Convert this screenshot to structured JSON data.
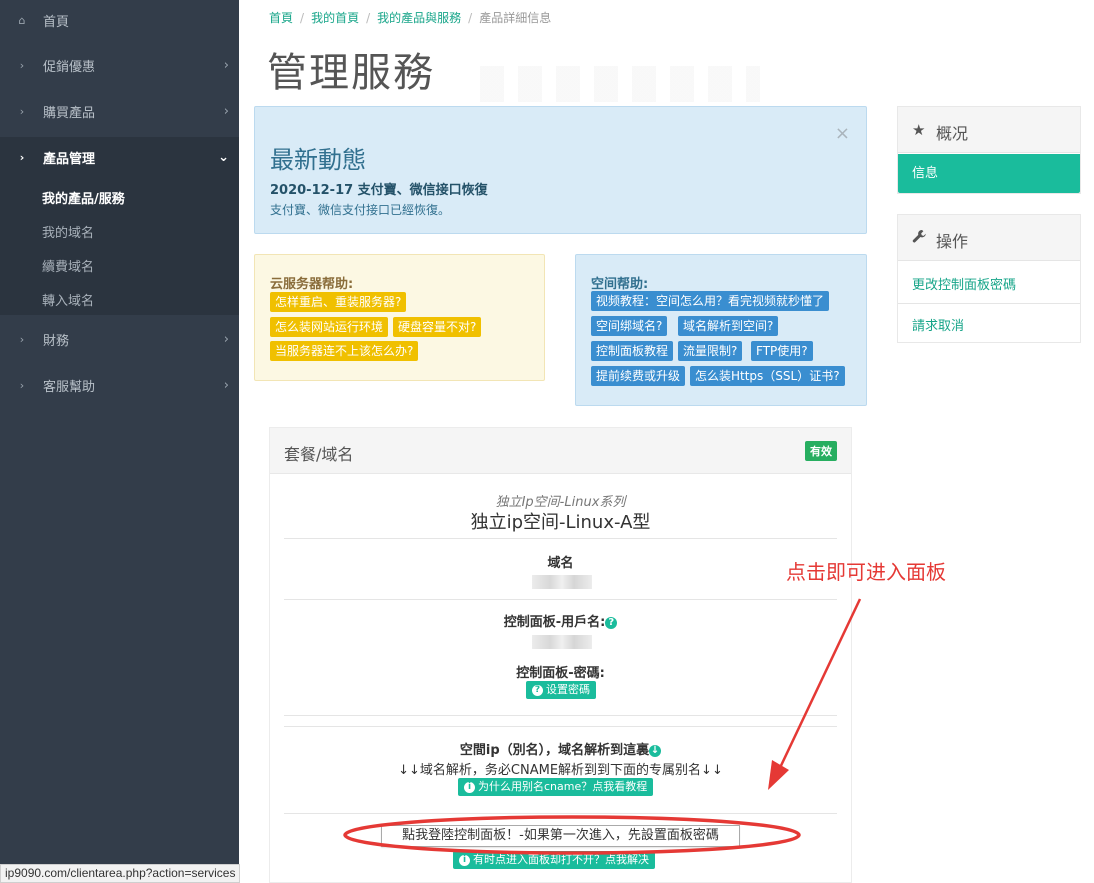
{
  "sidebar": {
    "items": [
      {
        "label": "首頁",
        "lead": "⌂"
      },
      {
        "label": "促銷優惠",
        "lead": "›"
      },
      {
        "label": "購買產品",
        "lead": "›"
      },
      {
        "label": "產品管理",
        "lead": "›"
      },
      {
        "label": "財務",
        "lead": "›"
      },
      {
        "label": "客服幫助",
        "lead": "›"
      }
    ],
    "sub_items": [
      "我的產品/服務",
      "我的域名",
      "續費域名",
      "轉入域名"
    ]
  },
  "breadcrumb": [
    "首頁",
    "我的首頁",
    "我的產品與服務",
    "產品詳細信息"
  ],
  "page_title": "管理服務",
  "announcement": {
    "heading": "最新動態",
    "date_title": "2020-12-17 支付寶、微信接口恢復",
    "body": "支付寶、微信支付接口已經恢復。",
    "close": "×"
  },
  "help_cloud": {
    "title": "云服务器帮助:",
    "tags": [
      "怎样重启、重装服务器?",
      "怎么装网站运行环境",
      "硬盘容量不对?",
      "当服务器连不上该怎么办?"
    ]
  },
  "help_space": {
    "title": "空间帮助:",
    "tags": [
      "视频教程：空间怎么用？看完视频就秒懂了",
      "空间绑域名?",
      "域名解析到空间?",
      "控制面板教程",
      "流量限制?",
      "FTP使用?",
      "提前续费或升级",
      "怎么装Https（SSL）证书?"
    ]
  },
  "overview_panel": {
    "title": "概况",
    "active_item": "信息",
    "icon": "★"
  },
  "actions_panel": {
    "title": "操作",
    "links": [
      "更改控制面板密碼",
      "請求取消"
    ],
    "icon": "🔧"
  },
  "card": {
    "title": "套餐/域名",
    "status": "有效",
    "product_group": "独立Ip空间-Linux系列",
    "product_name": "独立ip空间-Linux-A型",
    "domain_label": "域名",
    "username_label": "控制面板-用戶名:",
    "password_label": "控制面板-密碼:",
    "set_password_btn": "设置密碼",
    "alias_label": "空間ip（別名），域名解析到這裏",
    "alias_desc": "↓↓域名解析，务必CNAME解析到到下面的专属别名↓↓",
    "alias_help_btn": "为什么用别名cname？点我看教程",
    "login_btn": "點我登陸控制面板！-如果第一次進入，先設置面板密碼",
    "bottom_btn": "有时点进入面板却打不开？点我解决"
  },
  "annotation": {
    "text": "点击即可进入面板",
    "color": "#e53935"
  },
  "statusbar": {
    "url": "ip9090.com/clientarea.php?action=services"
  }
}
